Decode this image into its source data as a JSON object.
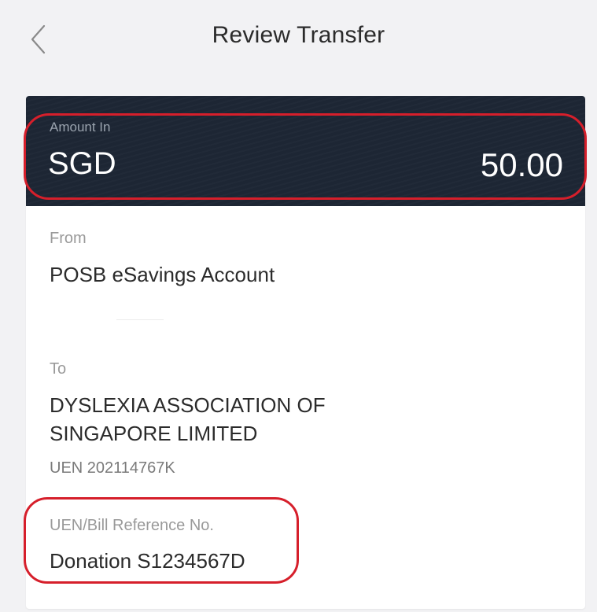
{
  "header": {
    "title": "Review Transfer",
    "back_icon": "chevron-left-icon"
  },
  "amount": {
    "label": "Amount In",
    "currency": "SGD",
    "value": "50.00"
  },
  "from": {
    "label": "From",
    "account": "POSB eSavings Account"
  },
  "to": {
    "label": "To",
    "name_line1": "DYSLEXIA ASSOCIATION OF",
    "name_line2": "SINGAPORE LIMITED",
    "uen": "UEN 202114767K"
  },
  "reference": {
    "label": "UEN/Bill Reference No.",
    "value": "Donation S1234567D"
  },
  "colors": {
    "background": "#f2f2f4",
    "amount_panel": "#1d2634",
    "highlight": "#d61f2b",
    "text_primary": "#2b2b2b",
    "text_label": "#9a9a9a"
  }
}
